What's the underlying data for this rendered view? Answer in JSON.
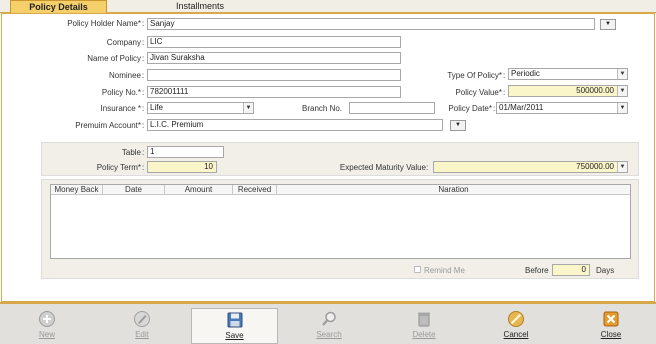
{
  "tabs": [
    "Policy Details",
    "Installments"
  ],
  "form": {
    "policy_holder_label": "Policy Holder Name*",
    "policy_holder_value": "Sanjay",
    "company_label": "Company",
    "company_value": "LIC",
    "name_of_policy_label": "Name of Policy",
    "name_of_policy_value": "Jivan Suraksha",
    "nominee_label": "Nominee",
    "nominee_value": "",
    "type_of_policy_label": "Type Of Policy*",
    "type_of_policy_value": "Periodic",
    "policy_no_label": "Policy No.*",
    "policy_no_value": "782001111",
    "policy_value_label": "Policy Value*",
    "policy_value_value": "500000.00",
    "insurance_label": "Insurance *",
    "insurance_value": "Life",
    "branch_no_label": "Branch No.",
    "branch_no_value": "",
    "policy_date_label": "Policy Date*",
    "policy_date_value": "01/Mar/2011",
    "premium_account_label": "Premuim Account*",
    "premium_account_value": "L.I.C. Premium"
  },
  "term": {
    "table_label": "Table",
    "table_value": "1",
    "policy_term_label": "Policy Term*",
    "policy_term_value": "10",
    "maturity_label": "Expected Maturity Value",
    "maturity_value": "750000.00"
  },
  "grid": {
    "columns": [
      "Money Back",
      "Date",
      "Amount",
      "Received",
      "Naration"
    ]
  },
  "reminder": {
    "remind_label": "Remind Me",
    "before_label": "Before",
    "before_value": "0",
    "days_label": "Days"
  },
  "toolbar": {
    "new": "New",
    "edit": "Edit",
    "save": "Save",
    "search": "Search",
    "delete": "Delete",
    "cancel": "Cancel",
    "close": "Close"
  }
}
